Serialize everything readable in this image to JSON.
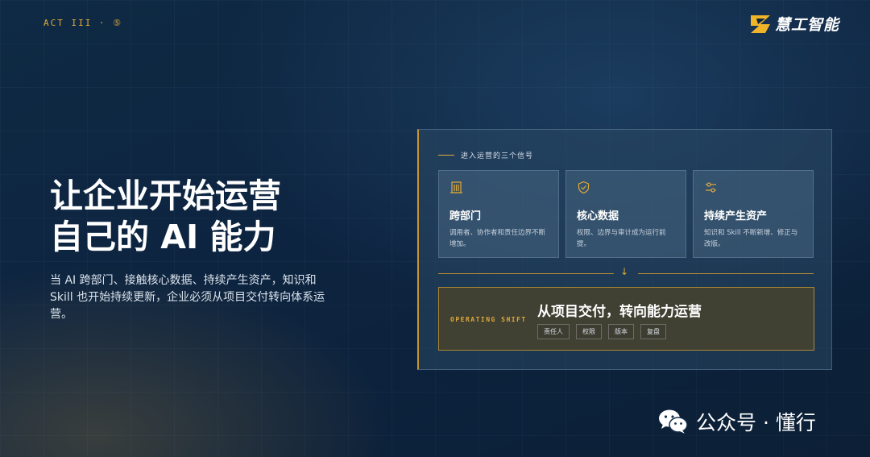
{
  "header": {
    "act_label": "ACT III · ⑤",
    "logo_text": "慧工智能"
  },
  "hero": {
    "title_line1": "让企业开始运营",
    "title_line2": "自己的 AI 能力",
    "description": "当 AI 跨部门、接触核心数据、持续产生资产，知识和 Skill 也开始持续更新，企业必须从项目交付转向体系运营。"
  },
  "panel": {
    "title": "进入运营的三个信号",
    "cards": [
      {
        "icon": "building-icon",
        "title": "跨部门",
        "desc": "调用者、协作者和责任边界不断增加。"
      },
      {
        "icon": "shield-check-icon",
        "title": "核心数据",
        "desc": "权限、边界与审计成为运行前提。"
      },
      {
        "icon": "sliders-icon",
        "title": "持续产生资产",
        "desc": "知识和 Skill 不断新增、修正与改版。"
      }
    ],
    "arrow": "↓",
    "shift": {
      "label": "OPERATING SHIFT",
      "title": "从项目交付，转向能力运营",
      "tags": [
        "责任人",
        "权限",
        "版本",
        "复盘"
      ]
    }
  },
  "watermark": {
    "text": "公众号 · 懂行"
  },
  "colors": {
    "accent": "#e0a93a",
    "background": "#0d2440"
  }
}
